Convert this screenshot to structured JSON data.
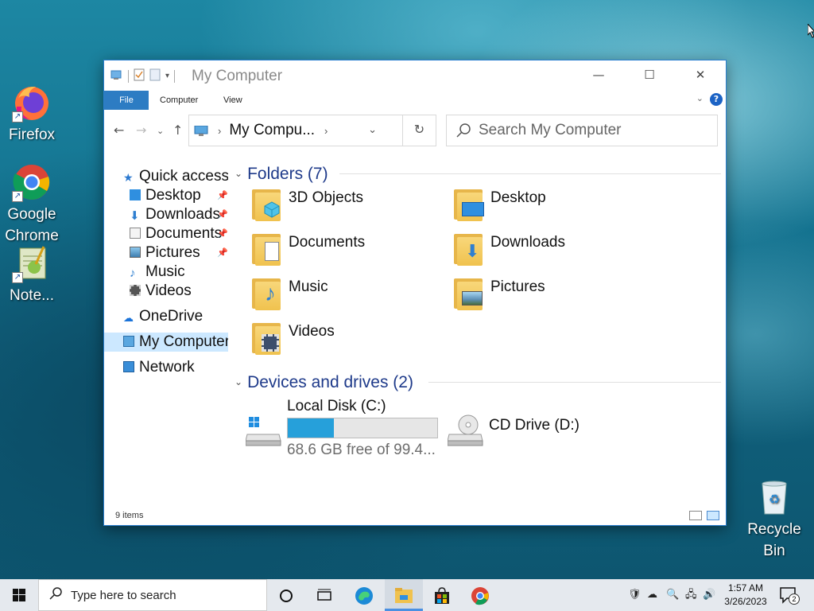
{
  "desktop": {
    "icons": [
      {
        "label": "Firefox"
      },
      {
        "label": "Google Chrome"
      },
      {
        "label": "Note..."
      },
      {
        "label": "Recycle Bin"
      }
    ]
  },
  "window": {
    "title": "My Computer",
    "ribbon_tabs": [
      "File",
      "Computer",
      "View"
    ],
    "address": "My Compu...",
    "search_placeholder": "Search My Computer",
    "status_count": "9 items"
  },
  "nav": {
    "quick_access": "Quick access",
    "items": [
      {
        "label": "Desktop",
        "icon": "desktop-icon",
        "pinned": true
      },
      {
        "label": "Downloads",
        "icon": "download-arrow-icon",
        "pinned": true
      },
      {
        "label": "Documents",
        "icon": "document-icon",
        "pinned": true
      },
      {
        "label": "Pictures",
        "icon": "pictures-icon",
        "pinned": true
      },
      {
        "label": "Music",
        "icon": "music-note-icon",
        "pinned": false
      },
      {
        "label": "Videos",
        "icon": "film-icon",
        "pinned": false
      }
    ],
    "onedrive": "OneDrive",
    "my_computer": "My Computer",
    "network": "Network"
  },
  "folders": {
    "heading": "Folders (7)",
    "items": [
      {
        "label": "3D Objects",
        "icon": "3d-objects-folder-icon"
      },
      {
        "label": "Desktop",
        "icon": "desktop-folder-icon"
      },
      {
        "label": "Documents",
        "icon": "documents-folder-icon"
      },
      {
        "label": "Downloads",
        "icon": "downloads-folder-icon"
      },
      {
        "label": "Music",
        "icon": "music-folder-icon"
      },
      {
        "label": "Pictures",
        "icon": "pictures-folder-icon"
      },
      {
        "label": "Videos",
        "icon": "videos-folder-icon"
      }
    ]
  },
  "drives": {
    "heading": "Devices and drives (2)",
    "local_disk": {
      "label": "Local Disk (C:)",
      "free_text": "68.6 GB free of 99.4...",
      "used_fraction": 0.31
    },
    "cd_drive": {
      "label": "CD Drive (D:)"
    }
  },
  "taskbar": {
    "search_placeholder": "Type here to search",
    "time": "1:57 AM",
    "date": "3/26/2023",
    "notification_count": "2"
  },
  "colors": {
    "accent": "#2d7cc3",
    "group_heading": "#1e3a8a",
    "disk_fill": "#26a0da"
  }
}
